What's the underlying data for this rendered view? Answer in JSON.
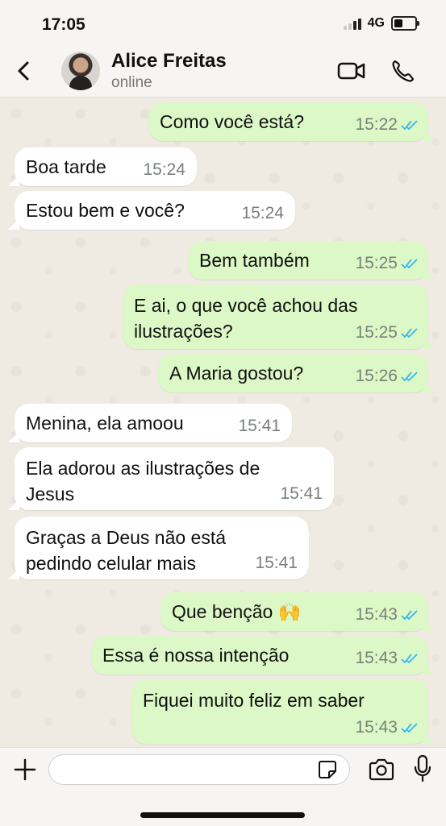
{
  "status_bar": {
    "time": "17:05",
    "network": "4G",
    "signal_bars": 4,
    "signal_bars_on": 2
  },
  "header": {
    "contact_name": "Alice Freitas",
    "contact_status": "online",
    "back_icon": "chevron-left-icon",
    "video_icon": "video-call-icon",
    "call_icon": "phone-icon"
  },
  "messages": [
    {
      "dir": "out",
      "text": "Como você está?",
      "time": "15:22",
      "read": true
    },
    {
      "dir": "in",
      "text": "Boa tarde",
      "time": "15:24"
    },
    {
      "dir": "in",
      "text": "Estou bem e você?",
      "time": "15:24"
    },
    {
      "dir": "out",
      "text": "Bem também",
      "time": "15:25",
      "read": true
    },
    {
      "dir": "out",
      "text": "E ai, o que você achou das\nilustrações?",
      "time": "15:25",
      "read": true
    },
    {
      "dir": "out",
      "text": "A Maria gostou?",
      "time": "15:26",
      "read": true
    },
    {
      "dir": "in",
      "text": "Menina, ela amoou",
      "time": "15:41"
    },
    {
      "dir": "in",
      "text": "Ela adorou as ilustrações de\nJesus",
      "time": "15:41"
    },
    {
      "dir": "in",
      "text": "Graças a Deus não está\npedindo celular mais",
      "time": "15:41"
    },
    {
      "dir": "out",
      "text": "Que benção 🙌",
      "time": "15:43",
      "read": true
    },
    {
      "dir": "out",
      "text": "Essa é nossa intenção",
      "time": "15:43",
      "read": true
    },
    {
      "dir": "out",
      "text": "Fiquei muito feliz em saber",
      "time": "15:43",
      "read": true
    }
  ],
  "input_bar": {
    "placeholder": "",
    "value": ""
  },
  "colors": {
    "outgoing_bubble": "#dcf8c6",
    "incoming_bubble": "#ffffff",
    "read_tick": "#34b7f1",
    "chat_background": "#efeae2"
  }
}
